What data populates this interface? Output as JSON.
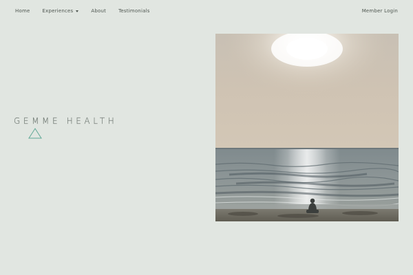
{
  "nav": {
    "items": [
      {
        "label": "Home",
        "has_dropdown": false
      },
      {
        "label": "Experiences",
        "has_dropdown": true
      },
      {
        "label": "About",
        "has_dropdown": false
      },
      {
        "label": "Testimonials",
        "has_dropdown": false
      }
    ],
    "member_login": "Member Login"
  },
  "logo": {
    "text": "GEMME HEALTH",
    "icon": "triangle-icon",
    "icon_color": "#5fa896"
  },
  "hero": {
    "image": "beach-sunset-photo"
  },
  "colors": {
    "background": "#e1e6e1",
    "nav_text": "#4e5650",
    "logo_text": "#717a74"
  }
}
